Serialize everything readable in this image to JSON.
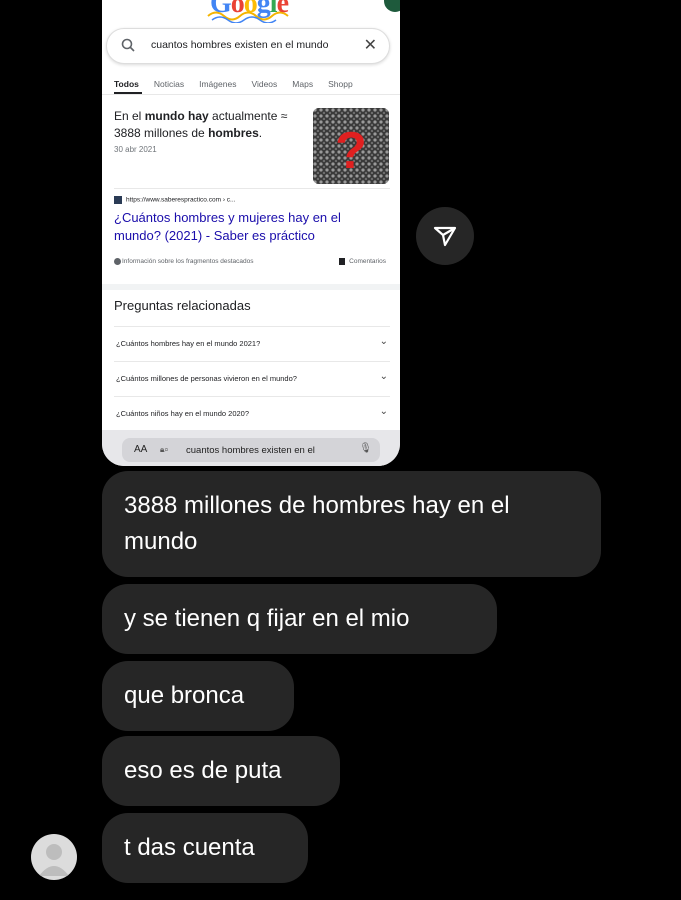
{
  "screenshot": {
    "logo": "Google",
    "search_query": "cuantos hombres existen en el mundo",
    "tabs": [
      "Todos",
      "Noticias",
      "Imágenes",
      "Videos",
      "Maps",
      "Shopp"
    ],
    "snippet": {
      "line1_pre": "En el ",
      "line1_bold": "mundo hay",
      "line1_post": " actualmente ≈",
      "line2_pre": "3888 millones de ",
      "line2_bold": "hombres",
      "line2_post": ".",
      "date": "30 abr 2021"
    },
    "source_url": "https://www.saberespractico.com › c...",
    "result_title": "¿Cuántos hombres y mujeres hay en el mundo? (2021) - Saber es práctico",
    "snippet_info": "Información sobre los fragmentos destacados",
    "comments": "Comentarios",
    "related_title": "Preguntas relacionadas",
    "related_questions": [
      "¿Cuántos hombres hay en el mundo 2021?",
      "¿Cuántos millones de personas vivieron en el mundo?",
      "¿Cuántos niños hay en el mundo 2020?"
    ],
    "url_bar": {
      "aa": "AA",
      "text": "cuantos hombres existen en el"
    }
  },
  "messages": [
    "3888 millones de hombres hay en el mundo",
    "y se tienen q fijar en el mio",
    "que bronca",
    "eso es de puta",
    "t das cuenta"
  ]
}
